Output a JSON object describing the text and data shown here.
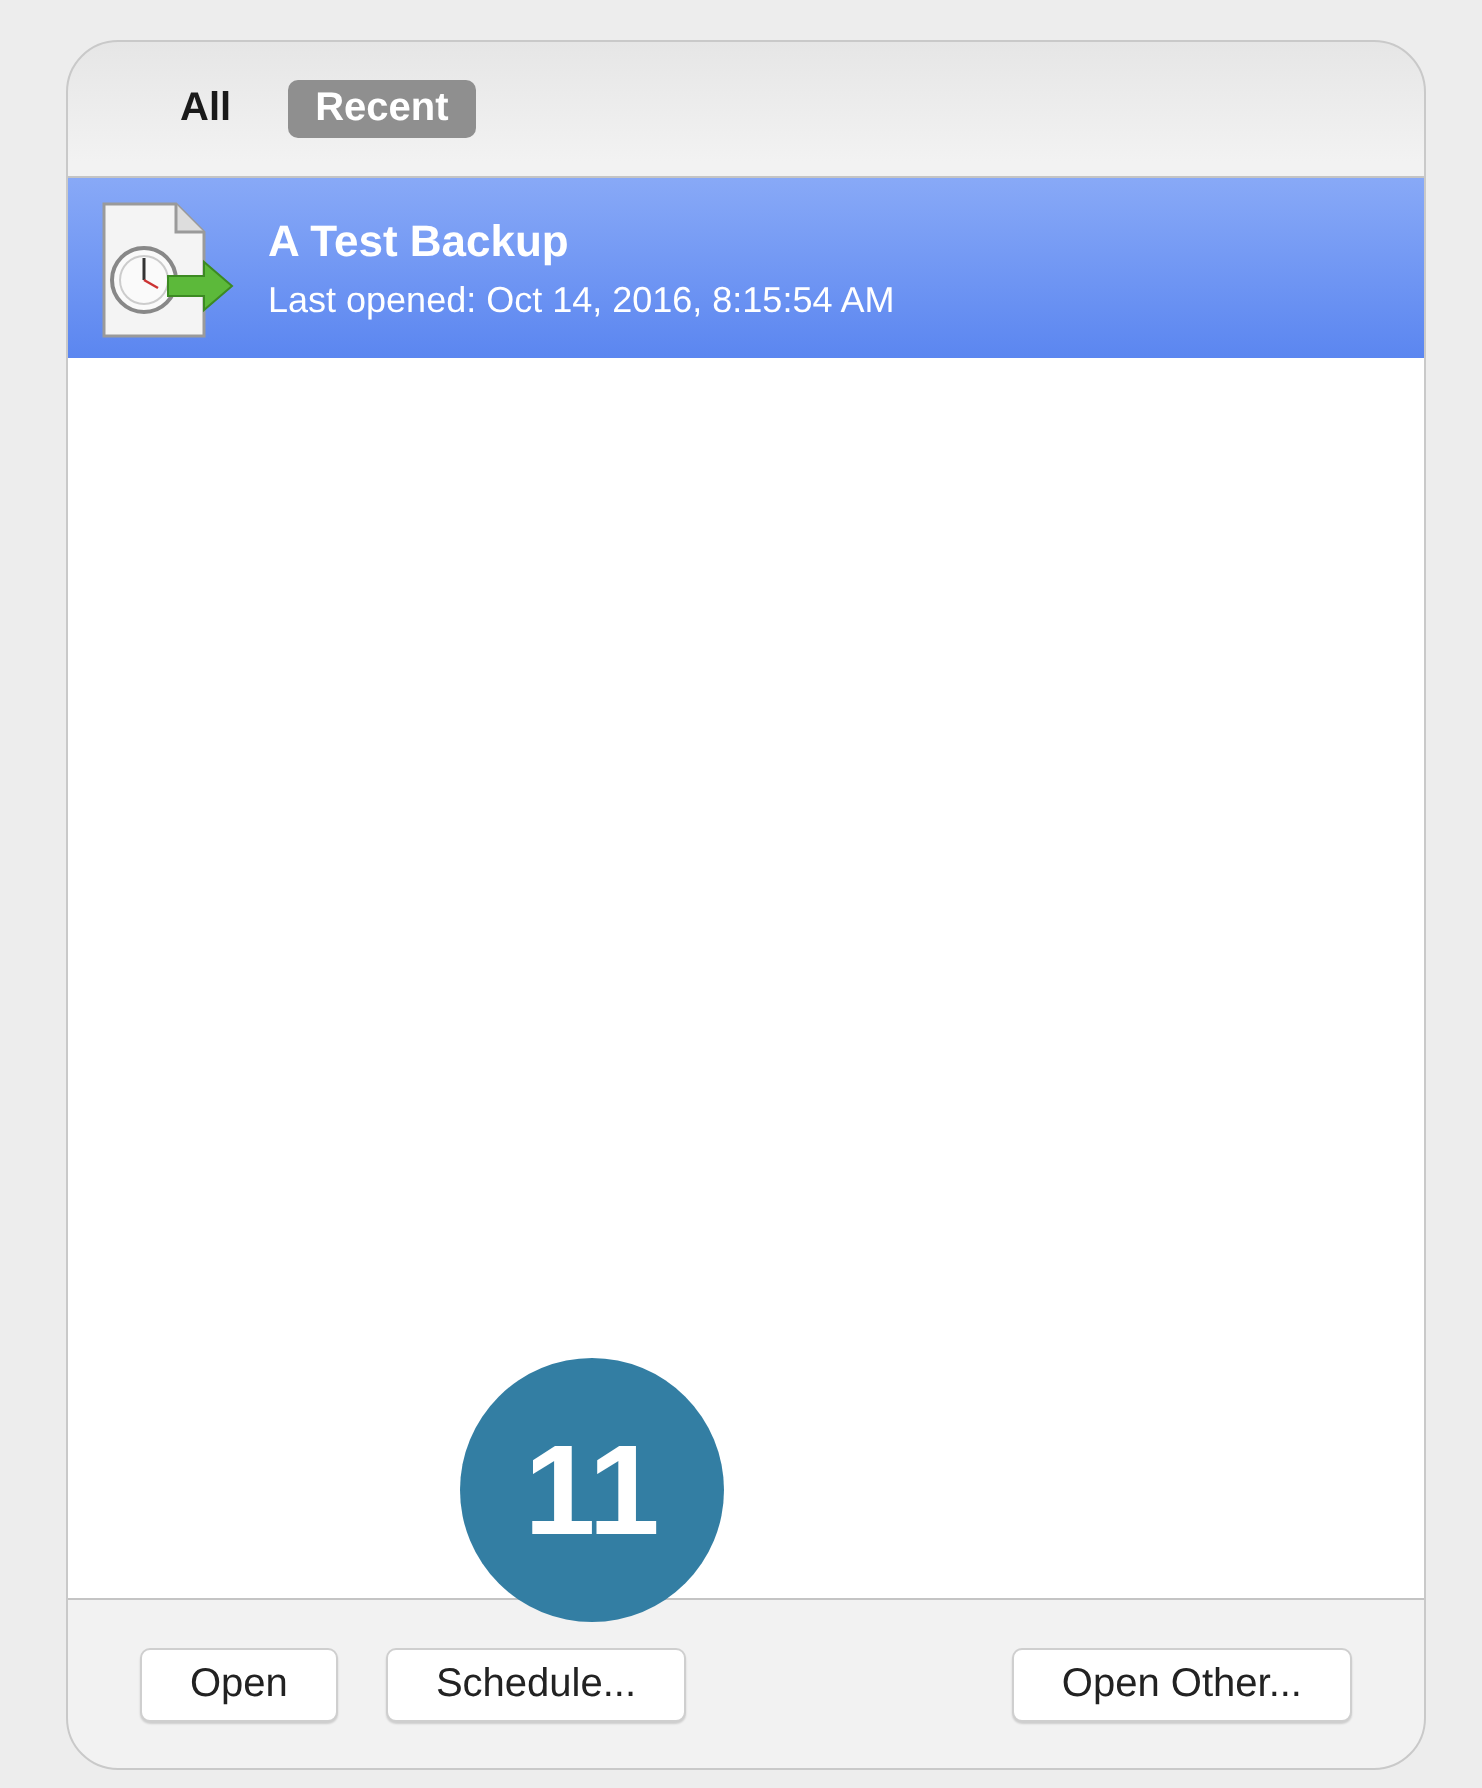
{
  "tabs": [
    {
      "label": "All",
      "selected": false
    },
    {
      "label": "Recent",
      "selected": true
    }
  ],
  "documents": [
    {
      "name": "A Test Backup",
      "detail": "Last opened:  Oct 14, 2016, 8:15:54 AM",
      "selected": true
    }
  ],
  "buttons": [
    "Open",
    "Schedule...",
    "Open Other..."
  ],
  "callout": "11"
}
